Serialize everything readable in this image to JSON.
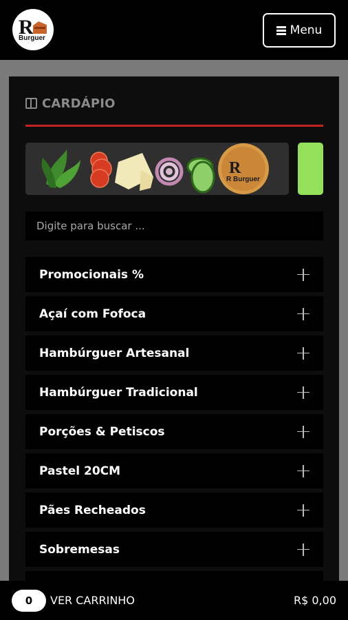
{
  "header": {
    "logo_text": "R Burguer",
    "menu_label": "Menu"
  },
  "menu_section": {
    "title": "CARDÁPIO"
  },
  "banner": {
    "logo_text": "R Burguer"
  },
  "search": {
    "placeholder": "Digite para buscar ..."
  },
  "categories": [
    {
      "label": "Promocionais %"
    },
    {
      "label": "Açaí com Fofoca"
    },
    {
      "label": "Hambúrguer Artesanal"
    },
    {
      "label": "Hambúrguer Tradicional"
    },
    {
      "label": "Porções & Petiscos"
    },
    {
      "label": "Pastel 20CM"
    },
    {
      "label": "Pães Recheados"
    },
    {
      "label": "Sobremesas"
    }
  ],
  "cart": {
    "count": "0",
    "label": "VER CARRINHO",
    "total": "R$ 0,00"
  },
  "colors": {
    "accent": "#c62222",
    "background": "#0d0d0d",
    "promo_green": "#95e05b"
  }
}
